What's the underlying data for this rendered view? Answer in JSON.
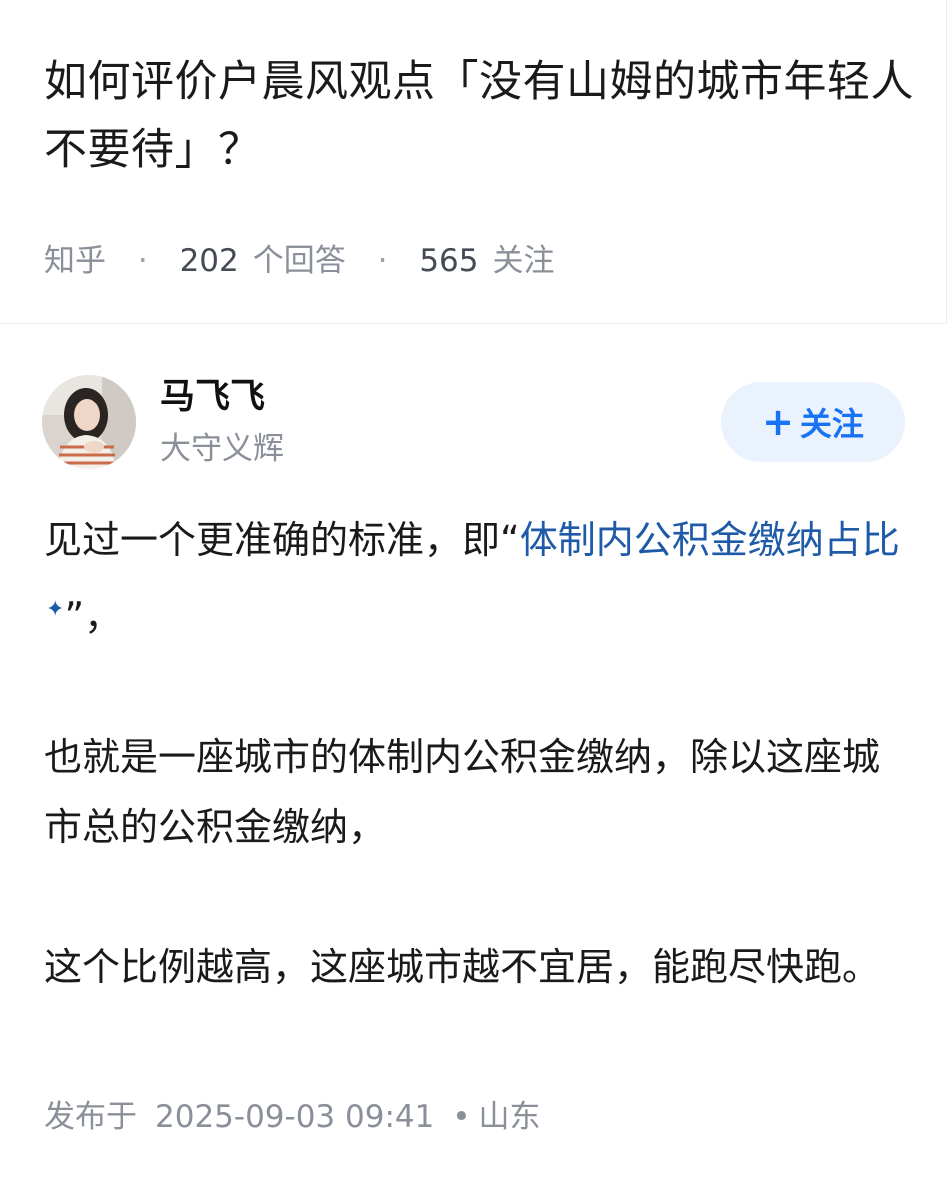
{
  "question": {
    "title": "如何评价户晨风观点「没有山姆的城市年轻人不要待」？",
    "source": "知乎",
    "answer_count": "202",
    "answer_label": "个回答",
    "follower_count": "565",
    "follower_label": "关注"
  },
  "author": {
    "name": "马飞飞",
    "bio": "大守义辉",
    "follow_label": "关注"
  },
  "answer": {
    "p1_prefix": "见过一个更准确的标准，即“",
    "p1_link": "体制内公积金缴纳占比",
    "p1_suffix": "”，",
    "p2": "也就是一座城市的体制内公积金缴纳，除以这座城市总的公积金缴纳，",
    "p3": "这个比例越高，这座城市越不宜居，能跑尽快跑。"
  },
  "meta": {
    "published_label": "发布于",
    "datetime": "2025-09-03  09:41",
    "separator": "•",
    "location": "山东"
  },
  "colors": {
    "accent": "#1772f6",
    "follow_bg": "#eaf2fd",
    "link": "#1e5aa8",
    "muted": "#8a8f99"
  },
  "icons": {
    "follow": "plus-icon",
    "link_marker": "sparkle-icon"
  }
}
